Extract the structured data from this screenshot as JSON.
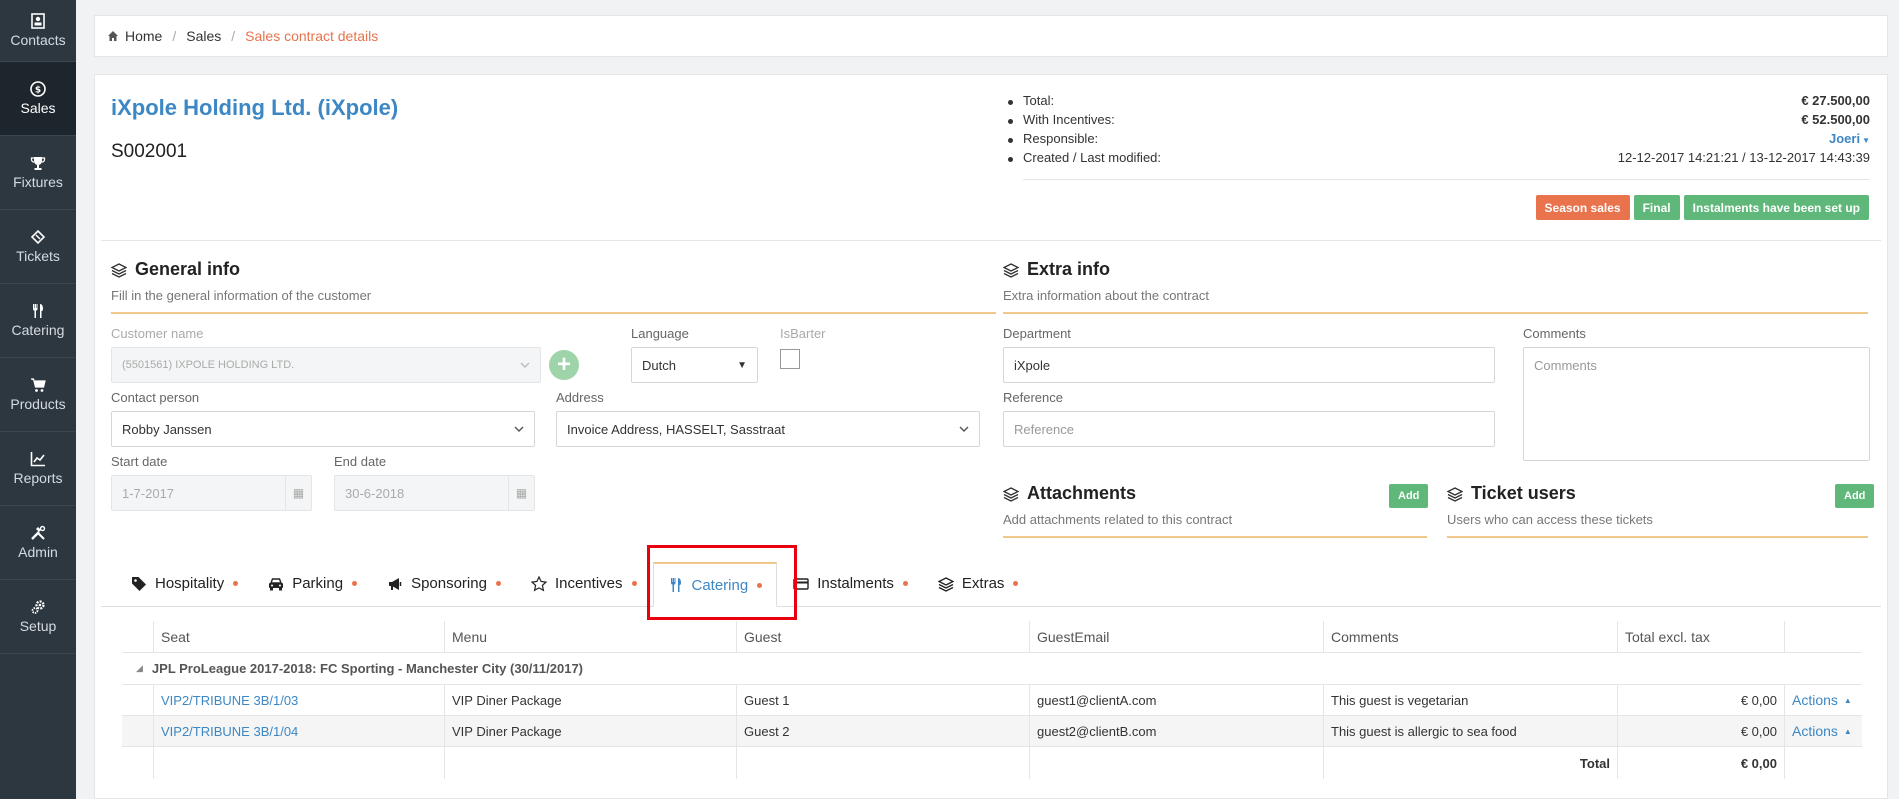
{
  "sidebar": {
    "items": [
      {
        "label": "Contacts",
        "icon": "contacts-icon"
      },
      {
        "label": "Sales",
        "icon": "dollar-icon"
      },
      {
        "label": "Fixtures",
        "icon": "trophy-icon"
      },
      {
        "label": "Tickets",
        "icon": "ticket-icon"
      },
      {
        "label": "Catering",
        "icon": "cutlery-icon"
      },
      {
        "label": "Products",
        "icon": "cart-icon"
      },
      {
        "label": "Reports",
        "icon": "chart-icon"
      },
      {
        "label": "Admin",
        "icon": "tools-icon"
      },
      {
        "label": "Setup",
        "icon": "gears-icon"
      }
    ]
  },
  "breadcrumb": {
    "home": "Home",
    "sales": "Sales",
    "current": "Sales contract details"
  },
  "contract": {
    "company": "iXpole Holding Ltd. (iXpole)",
    "number": "S002001"
  },
  "summary": {
    "total_label": "Total:",
    "total_value": "€ 27.500,00",
    "incentives_label": "With Incentives:",
    "incentives_value": "€ 52.500,00",
    "responsible_label": "Responsible:",
    "responsible_value": "Joeri",
    "created_label": "Created / Last modified:",
    "created_value": "12-12-2017 14:21:21 / 13-12-2017 14:43:39"
  },
  "badges": [
    "Season sales",
    "Final",
    "Instalments have been set up"
  ],
  "general": {
    "title": "General info",
    "subtitle": "Fill in the general information of the customer",
    "customer_label": "Customer name",
    "customer_value": "(5501561) IXPOLE HOLDING LTD.",
    "language_label": "Language",
    "language_value": "Dutch",
    "barter_label": "IsBarter",
    "contact_label": "Contact person",
    "contact_value": "Robby Janssen",
    "address_label": "Address",
    "address_value": "Invoice Address, HASSELT, Sasstraat",
    "start_label": "Start date",
    "start_value": "1-7-2017",
    "end_label": "End date",
    "end_value": "30-6-2018"
  },
  "extra": {
    "title": "Extra info",
    "subtitle": "Extra information about the contract",
    "department_label": "Department",
    "department_value": "iXpole",
    "comments_label": "Comments",
    "comments_placeholder": "Comments",
    "reference_label": "Reference",
    "reference_placeholder": "Reference"
  },
  "attachments": {
    "title": "Attachments",
    "subtitle": "Add attachments related to this contract",
    "add": "Add"
  },
  "ticket_users": {
    "title": "Ticket users",
    "subtitle": "Users who can access these tickets",
    "add": "Add"
  },
  "tabs": [
    {
      "label": "Hospitality",
      "icon": "tag-icon"
    },
    {
      "label": "Parking",
      "icon": "car-icon"
    },
    {
      "label": "Sponsoring",
      "icon": "megaphone-icon"
    },
    {
      "label": "Incentives",
      "icon": "star-icon"
    },
    {
      "label": "Catering",
      "icon": "cutlery-icon"
    },
    {
      "label": "Instalments",
      "icon": "credit-card-icon"
    },
    {
      "label": "Extras",
      "icon": "layers-icon"
    }
  ],
  "table": {
    "headers": [
      "Seat",
      "Menu",
      "Guest",
      "GuestEmail",
      "Comments",
      "Total excl. tax"
    ],
    "group": "JPL ProLeague 2017-2018: FC Sporting - Manchester City (30/11/2017)",
    "rows": [
      {
        "seat": "VIP2/TRIBUNE 3B/1/03",
        "menu": "VIP Diner Package",
        "guest": "Guest 1",
        "email": "guest1@clientA.com",
        "comments": "This guest is vegetarian",
        "total": "€ 0,00",
        "actions": "Actions"
      },
      {
        "seat": "VIP2/TRIBUNE 3B/1/04",
        "menu": "VIP Diner Package",
        "guest": "Guest 2",
        "email": "guest2@clientB.com",
        "comments": "This guest is allergic to sea food",
        "total": "€ 0,00",
        "actions": "Actions"
      }
    ],
    "total_label": "Total",
    "total_value": "€ 0,00"
  }
}
